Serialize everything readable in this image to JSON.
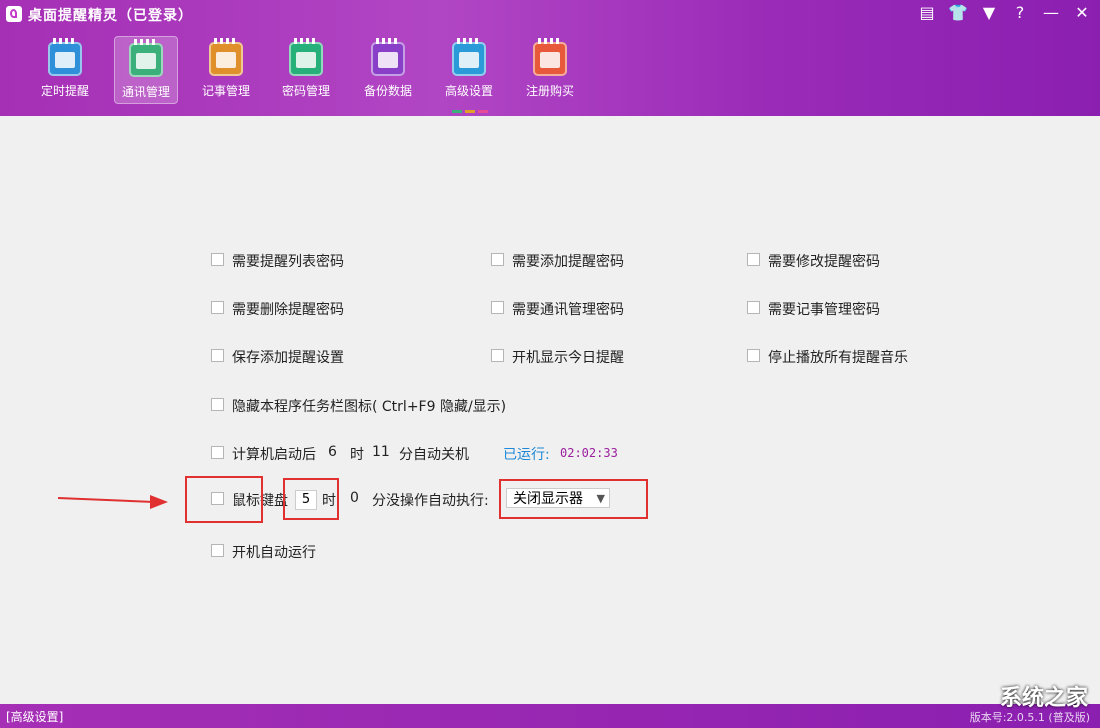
{
  "window": {
    "title": "桌面提醒精灵（已登录）",
    "buttons": [
      "▤",
      "👕",
      "▼",
      "?",
      "—",
      "✕"
    ]
  },
  "toolbar": [
    {
      "label": "定时提醒",
      "icon": "clock-calendar-icon",
      "color": "#2f8fd8"
    },
    {
      "label": "通讯管理",
      "icon": "contacts-calendar-icon",
      "color": "#3bb07a",
      "active": true
    },
    {
      "label": "记事管理",
      "icon": "notes-pencil-icon",
      "color": "#e0902a"
    },
    {
      "label": "密码管理",
      "icon": "password-briefcase-icon",
      "color": "#28b07a"
    },
    {
      "label": "备份数据",
      "icon": "backup-disk-icon",
      "color": "#8a3fc8"
    },
    {
      "label": "高级设置",
      "icon": "advanced-gear-icon",
      "color": "#2a9ad8"
    },
    {
      "label": "注册购买",
      "icon": "register-purchase-icon",
      "color": "#e8583a"
    }
  ],
  "options": {
    "row1": [
      "需要提醒列表密码",
      "需要添加提醒密码",
      "需要修改提醒密码"
    ],
    "row2": [
      "需要删除提醒密码",
      "需要通讯管理密码",
      "需要记事管理密码"
    ],
    "row3": [
      "保存添加提醒设置",
      "开机显示今日提醒",
      "停止播放所有提醒音乐"
    ],
    "hide_taskbar": "隐藏本程序任务栏图标( Ctrl+F9  隐藏/显示)",
    "shutdown": {
      "prefix": "计算机启动后",
      "hours": "6",
      "hour_unit": "时",
      "minutes": "11",
      "suffix": "分自动关机",
      "running_label": "已运行:",
      "running_time": "02:02:33"
    },
    "idle": {
      "label": "鼠标键盘",
      "hours": "5",
      "hour_unit": "时",
      "minutes": "0",
      "suffix": "分没操作自动执行:",
      "action": "关闭显示器"
    },
    "autostart": "开机自动运行"
  },
  "status": {
    "left": "[高级设置]",
    "right": "版本号:2.0.5.1 (普及版)"
  },
  "watermark": "系统之家"
}
